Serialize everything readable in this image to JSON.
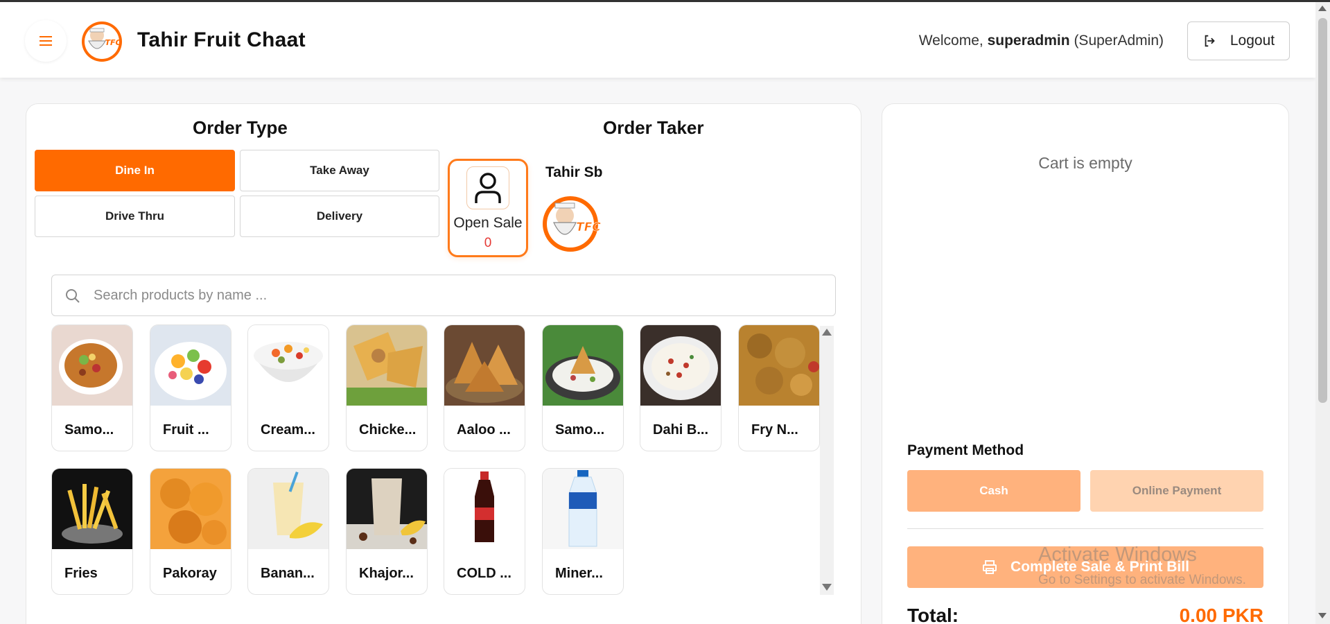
{
  "app": {
    "brand": "Tahir Fruit Chaat",
    "welcome_prefix": "Welcome,",
    "username": "superadmin",
    "role": "(SuperAdmin)",
    "logout_label": "Logout",
    "logo_text": "TFC"
  },
  "order_type": {
    "title": "Order Type",
    "options": [
      {
        "label": "Dine In",
        "active": true
      },
      {
        "label": "Take Away",
        "active": false
      },
      {
        "label": "Drive Thru",
        "active": false
      },
      {
        "label": "Delivery",
        "active": false
      }
    ]
  },
  "order_taker": {
    "title": "Order Taker",
    "card_label": "Open Sale",
    "card_count": "0",
    "name": "Tahir Sb"
  },
  "search": {
    "placeholder": "Search products by name ..."
  },
  "products": [
    {
      "name": "Samo...",
      "icon": "samosa-chaat-image"
    },
    {
      "name": "Fruit ...",
      "icon": "fruit-chaat-image"
    },
    {
      "name": "Cream...",
      "icon": "cream-chaat-image"
    },
    {
      "name": "Chicke...",
      "icon": "chicken-roll-image"
    },
    {
      "name": "Aaloo ...",
      "icon": "aaloo-samosa-image"
    },
    {
      "name": "Samo...",
      "icon": "samosa-plate-image"
    },
    {
      "name": "Dahi B...",
      "icon": "dahi-bhalla-image"
    },
    {
      "name": "Fry N...",
      "icon": "fry-nimko-image"
    },
    {
      "name": "Fries",
      "icon": "fries-image"
    },
    {
      "name": "Pakoray",
      "icon": "pakoray-image"
    },
    {
      "name": "Banan...",
      "icon": "banana-shake-image"
    },
    {
      "name": "Khajor...",
      "icon": "khajoor-shake-image"
    },
    {
      "name": "COLD ...",
      "icon": "cold-drink-image"
    },
    {
      "name": "Miner...",
      "icon": "mineral-water-image"
    }
  ],
  "cart": {
    "empty_text": "Cart is empty",
    "payment_label": "Payment Method",
    "cash_label": "Cash",
    "online_label": "Online Payment",
    "complete_label": "Complete Sale & Print Bill",
    "total_label": "Total:",
    "total_value": "0.00 PKR"
  },
  "watermark": {
    "line1": "Activate Windows",
    "line2": "Go to Settings to activate Windows."
  },
  "colors": {
    "accent": "#ff6a00",
    "accent_light": "#ffb27d",
    "count_red": "#e53935"
  }
}
